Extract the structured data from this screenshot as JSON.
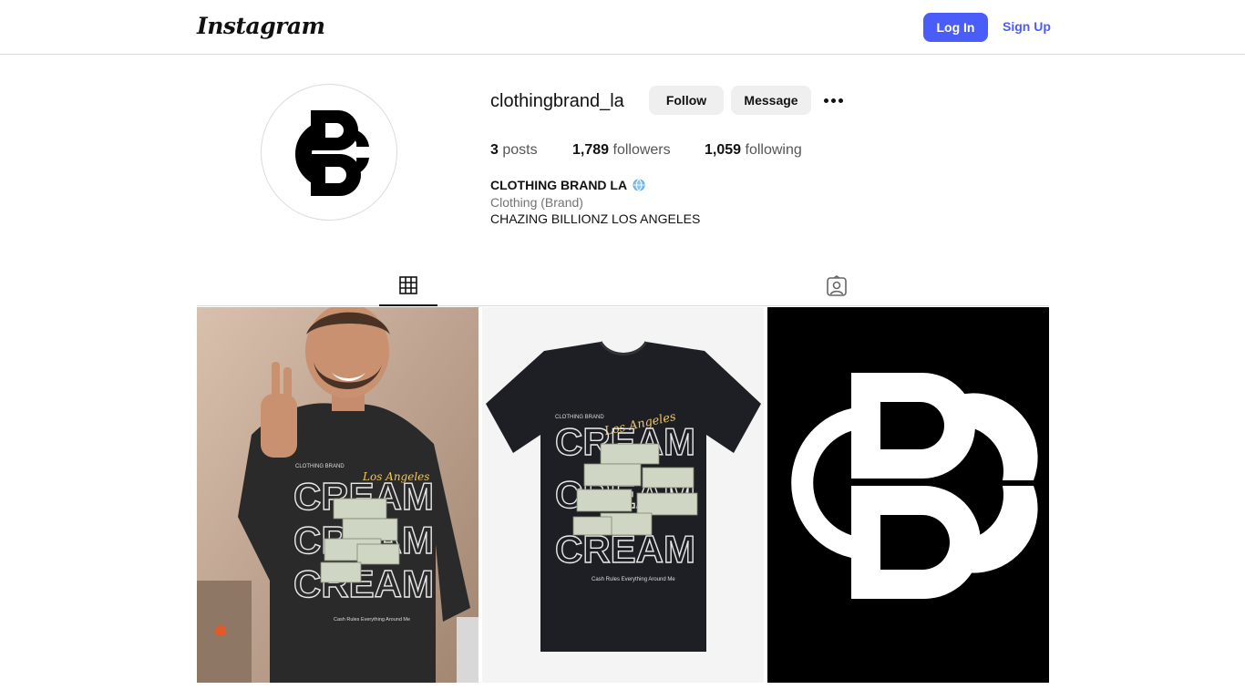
{
  "header": {
    "logo_text": "Instagram",
    "login_label": "Log In",
    "signup_label": "Sign Up",
    "accent_color": "#4a5df9"
  },
  "profile": {
    "username": "clothingbrand_la",
    "follow_label": "Follow",
    "message_label": "Message",
    "more_icon": "more-options-icon",
    "posts_count": "3",
    "posts_label": "posts",
    "followers_count": "1,789",
    "followers_label": "followers",
    "following_count": "1,059",
    "following_label": "following",
    "full_name": "CLOTHING BRAND LA",
    "category": "Clothing (Brand)",
    "bio": "CHAZING BILLIONZ LOS ANGELES"
  },
  "tabs": [
    {
      "icon": "grid-icon",
      "active": true
    },
    {
      "icon": "tagged-icon",
      "active": false
    }
  ],
  "posts": [
    {
      "subject": "man wearing CREAM t-shirt",
      "shirt_brand": "CLOTHING BRAND",
      "script": "Los Angeles",
      "word": "CREAM",
      "tagline": "Cash Rules Everything Around Me"
    },
    {
      "subject": "CREAM t-shirt product shot",
      "shirt_brand": "CLOTHING BRAND",
      "script": "Los Angeles",
      "word": "CREAM",
      "tagline": "Cash Rules Everything Around Me"
    },
    {
      "subject": "CB logo on black"
    }
  ]
}
